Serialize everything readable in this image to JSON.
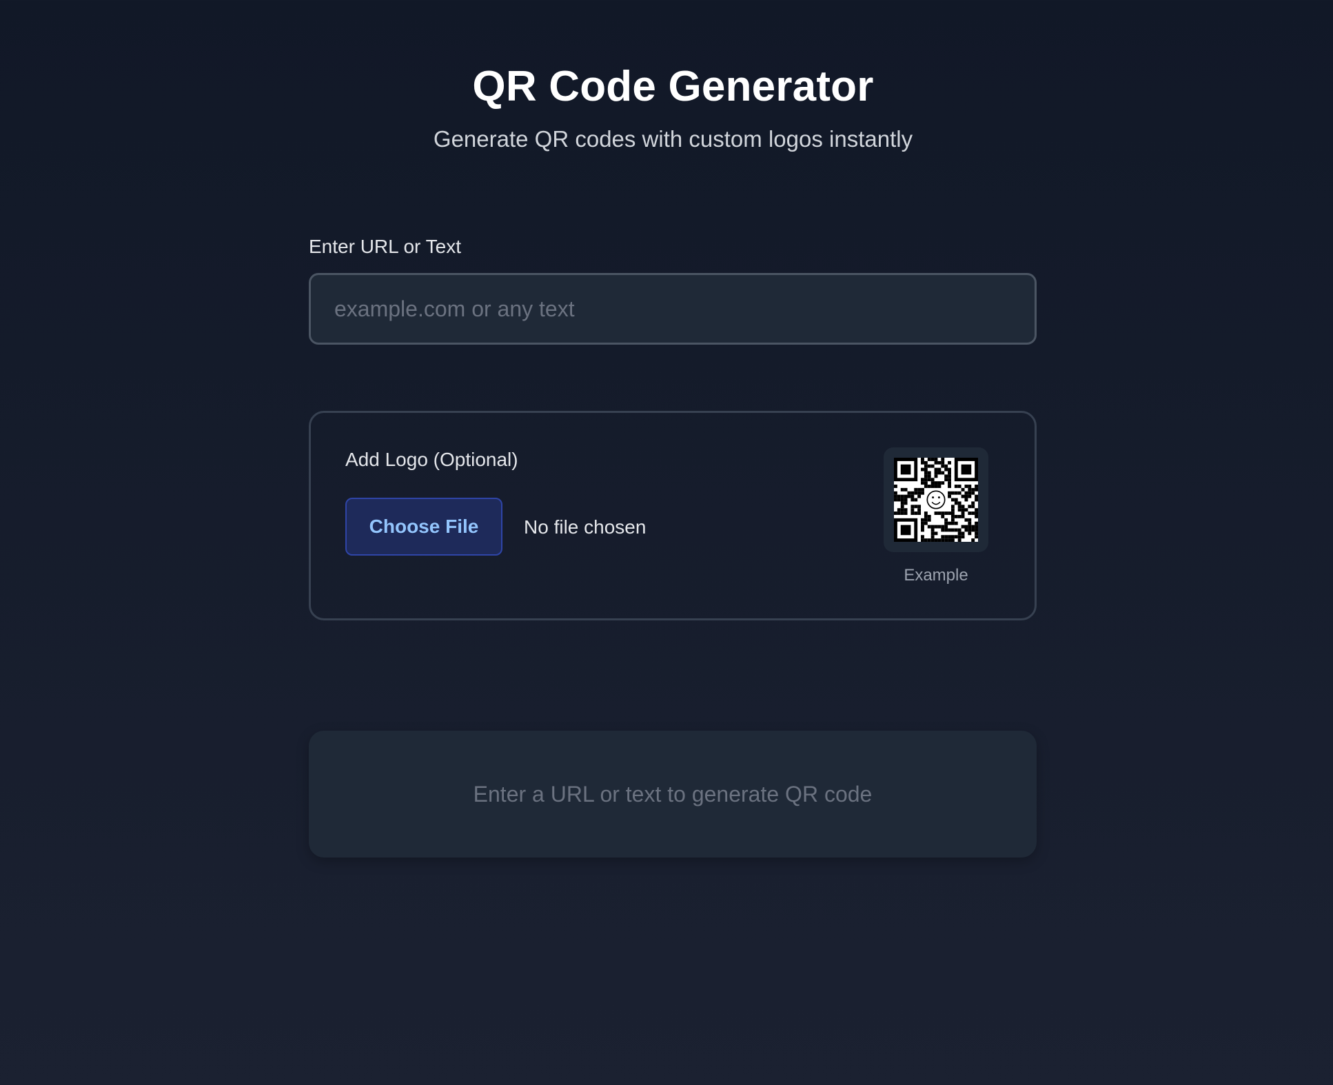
{
  "header": {
    "title": "QR Code Generator",
    "subtitle": "Generate QR codes with custom logos instantly"
  },
  "input": {
    "label": "Enter URL or Text",
    "placeholder": "example.com or any text",
    "value": ""
  },
  "logo": {
    "label": "Add Logo (Optional)",
    "choose_button": "Choose File",
    "file_status": "No file chosen",
    "example_caption": "Example",
    "example_icon": "qr-code-with-smiley-icon"
  },
  "output": {
    "empty_message": "Enter a URL or text to generate QR code"
  },
  "colors": {
    "background": "#111827",
    "panel": "#1f2937",
    "accent_text": "#93c5fd",
    "accent_bg": "#1e2a5a"
  }
}
